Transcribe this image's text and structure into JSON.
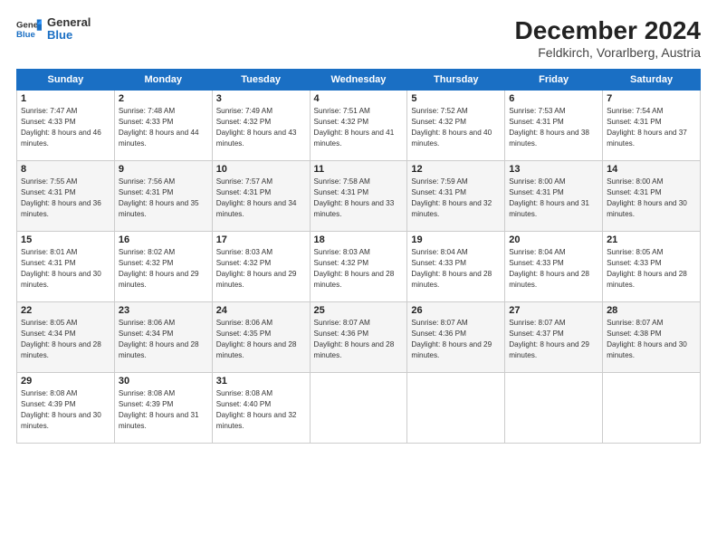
{
  "header": {
    "logo_general": "General",
    "logo_blue": "Blue",
    "month": "December 2024",
    "location": "Feldkirch, Vorarlberg, Austria"
  },
  "weekdays": [
    "Sunday",
    "Monday",
    "Tuesday",
    "Wednesday",
    "Thursday",
    "Friday",
    "Saturday"
  ],
  "weeks": [
    [
      {
        "day": "1",
        "sunrise": "Sunrise: 7:47 AM",
        "sunset": "Sunset: 4:33 PM",
        "daylight": "Daylight: 8 hours and 46 minutes."
      },
      {
        "day": "2",
        "sunrise": "Sunrise: 7:48 AM",
        "sunset": "Sunset: 4:33 PM",
        "daylight": "Daylight: 8 hours and 44 minutes."
      },
      {
        "day": "3",
        "sunrise": "Sunrise: 7:49 AM",
        "sunset": "Sunset: 4:32 PM",
        "daylight": "Daylight: 8 hours and 43 minutes."
      },
      {
        "day": "4",
        "sunrise": "Sunrise: 7:51 AM",
        "sunset": "Sunset: 4:32 PM",
        "daylight": "Daylight: 8 hours and 41 minutes."
      },
      {
        "day": "5",
        "sunrise": "Sunrise: 7:52 AM",
        "sunset": "Sunset: 4:32 PM",
        "daylight": "Daylight: 8 hours and 40 minutes."
      },
      {
        "day": "6",
        "sunrise": "Sunrise: 7:53 AM",
        "sunset": "Sunset: 4:31 PM",
        "daylight": "Daylight: 8 hours and 38 minutes."
      },
      {
        "day": "7",
        "sunrise": "Sunrise: 7:54 AM",
        "sunset": "Sunset: 4:31 PM",
        "daylight": "Daylight: 8 hours and 37 minutes."
      }
    ],
    [
      {
        "day": "8",
        "sunrise": "Sunrise: 7:55 AM",
        "sunset": "Sunset: 4:31 PM",
        "daylight": "Daylight: 8 hours and 36 minutes."
      },
      {
        "day": "9",
        "sunrise": "Sunrise: 7:56 AM",
        "sunset": "Sunset: 4:31 PM",
        "daylight": "Daylight: 8 hours and 35 minutes."
      },
      {
        "day": "10",
        "sunrise": "Sunrise: 7:57 AM",
        "sunset": "Sunset: 4:31 PM",
        "daylight": "Daylight: 8 hours and 34 minutes."
      },
      {
        "day": "11",
        "sunrise": "Sunrise: 7:58 AM",
        "sunset": "Sunset: 4:31 PM",
        "daylight": "Daylight: 8 hours and 33 minutes."
      },
      {
        "day": "12",
        "sunrise": "Sunrise: 7:59 AM",
        "sunset": "Sunset: 4:31 PM",
        "daylight": "Daylight: 8 hours and 32 minutes."
      },
      {
        "day": "13",
        "sunrise": "Sunrise: 8:00 AM",
        "sunset": "Sunset: 4:31 PM",
        "daylight": "Daylight: 8 hours and 31 minutes."
      },
      {
        "day": "14",
        "sunrise": "Sunrise: 8:00 AM",
        "sunset": "Sunset: 4:31 PM",
        "daylight": "Daylight: 8 hours and 30 minutes."
      }
    ],
    [
      {
        "day": "15",
        "sunrise": "Sunrise: 8:01 AM",
        "sunset": "Sunset: 4:31 PM",
        "daylight": "Daylight: 8 hours and 30 minutes."
      },
      {
        "day": "16",
        "sunrise": "Sunrise: 8:02 AM",
        "sunset": "Sunset: 4:32 PM",
        "daylight": "Daylight: 8 hours and 29 minutes."
      },
      {
        "day": "17",
        "sunrise": "Sunrise: 8:03 AM",
        "sunset": "Sunset: 4:32 PM",
        "daylight": "Daylight: 8 hours and 29 minutes."
      },
      {
        "day": "18",
        "sunrise": "Sunrise: 8:03 AM",
        "sunset": "Sunset: 4:32 PM",
        "daylight": "Daylight: 8 hours and 28 minutes."
      },
      {
        "day": "19",
        "sunrise": "Sunrise: 8:04 AM",
        "sunset": "Sunset: 4:33 PM",
        "daylight": "Daylight: 8 hours and 28 minutes."
      },
      {
        "day": "20",
        "sunrise": "Sunrise: 8:04 AM",
        "sunset": "Sunset: 4:33 PM",
        "daylight": "Daylight: 8 hours and 28 minutes."
      },
      {
        "day": "21",
        "sunrise": "Sunrise: 8:05 AM",
        "sunset": "Sunset: 4:33 PM",
        "daylight": "Daylight: 8 hours and 28 minutes."
      }
    ],
    [
      {
        "day": "22",
        "sunrise": "Sunrise: 8:05 AM",
        "sunset": "Sunset: 4:34 PM",
        "daylight": "Daylight: 8 hours and 28 minutes."
      },
      {
        "day": "23",
        "sunrise": "Sunrise: 8:06 AM",
        "sunset": "Sunset: 4:34 PM",
        "daylight": "Daylight: 8 hours and 28 minutes."
      },
      {
        "day": "24",
        "sunrise": "Sunrise: 8:06 AM",
        "sunset": "Sunset: 4:35 PM",
        "daylight": "Daylight: 8 hours and 28 minutes."
      },
      {
        "day": "25",
        "sunrise": "Sunrise: 8:07 AM",
        "sunset": "Sunset: 4:36 PM",
        "daylight": "Daylight: 8 hours and 28 minutes."
      },
      {
        "day": "26",
        "sunrise": "Sunrise: 8:07 AM",
        "sunset": "Sunset: 4:36 PM",
        "daylight": "Daylight: 8 hours and 29 minutes."
      },
      {
        "day": "27",
        "sunrise": "Sunrise: 8:07 AM",
        "sunset": "Sunset: 4:37 PM",
        "daylight": "Daylight: 8 hours and 29 minutes."
      },
      {
        "day": "28",
        "sunrise": "Sunrise: 8:07 AM",
        "sunset": "Sunset: 4:38 PM",
        "daylight": "Daylight: 8 hours and 30 minutes."
      }
    ],
    [
      {
        "day": "29",
        "sunrise": "Sunrise: 8:08 AM",
        "sunset": "Sunset: 4:39 PM",
        "daylight": "Daylight: 8 hours and 30 minutes."
      },
      {
        "day": "30",
        "sunrise": "Sunrise: 8:08 AM",
        "sunset": "Sunset: 4:39 PM",
        "daylight": "Daylight: 8 hours and 31 minutes."
      },
      {
        "day": "31",
        "sunrise": "Sunrise: 8:08 AM",
        "sunset": "Sunset: 4:40 PM",
        "daylight": "Daylight: 8 hours and 32 minutes."
      },
      null,
      null,
      null,
      null
    ]
  ]
}
